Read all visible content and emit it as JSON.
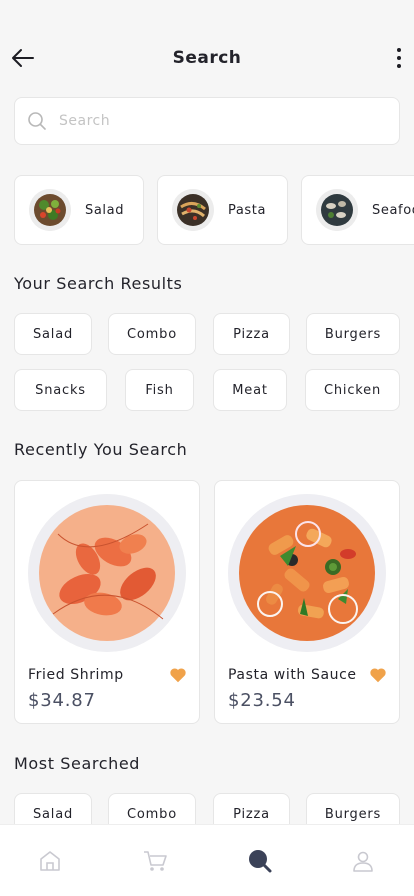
{
  "header": {
    "title": "Search"
  },
  "search": {
    "placeholder": "Search",
    "value": ""
  },
  "categories": [
    {
      "label": "Salad"
    },
    {
      "label": "Pasta"
    },
    {
      "label": "Seafood"
    }
  ],
  "search_results": {
    "title": "Your Search Results",
    "chips": [
      "Salad",
      "Combo",
      "Pizza",
      "Burgers",
      "Snacks",
      "Fish",
      "Meat",
      "Chicken"
    ]
  },
  "recent": {
    "title": "Recently You Search",
    "items": [
      {
        "name": "Fried Shrimp",
        "price": "$34.87",
        "favorited": true
      },
      {
        "name": "Pasta with Sauce",
        "price": "$23.54",
        "favorited": true
      }
    ]
  },
  "most_searched": {
    "title": "Most Searched",
    "chips": [
      "Salad",
      "Combo",
      "Pizza",
      "Burgers"
    ]
  },
  "colors": {
    "accent_heart": "#f0a24a",
    "nav_active": "#3b4258",
    "nav_inactive": "#c9c9d0"
  },
  "icons": {
    "back": "arrow-left-icon",
    "more": "more-vertical-icon",
    "search": "search-icon",
    "heart": "heart-icon",
    "nav": [
      "home-icon",
      "cart-icon",
      "search-icon",
      "user-icon"
    ]
  }
}
